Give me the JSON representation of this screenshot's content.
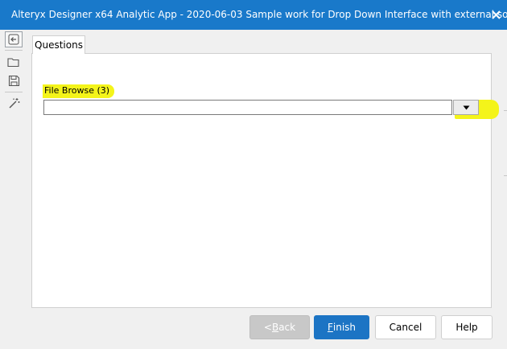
{
  "window": {
    "title": "Alteryx Designer x64 Analytic App - 2020-06-03 Sample work for Drop Down Interface with external source",
    "close_glyph": "✕",
    "title_bar_color": "#1979ca"
  },
  "toolbar": {
    "icons": [
      "back-icon",
      "open-folder-icon",
      "save-icon",
      "magic-wand-icon"
    ]
  },
  "tabs": [
    {
      "label": "Questions",
      "selected": true
    }
  ],
  "questions": {
    "file_browse": {
      "label": "File Browse (3)",
      "value": "",
      "dropdown_glyph": "▼"
    }
  },
  "buttons": {
    "back": {
      "prefix": "< ",
      "accel": "B",
      "rest": "ack",
      "enabled": false
    },
    "finish": {
      "accel": "F",
      "rest": "inish"
    },
    "cancel": "Cancel",
    "help": "Help"
  },
  "colors": {
    "highlight": "#f4f41a",
    "primary_button": "#1c74c4"
  }
}
